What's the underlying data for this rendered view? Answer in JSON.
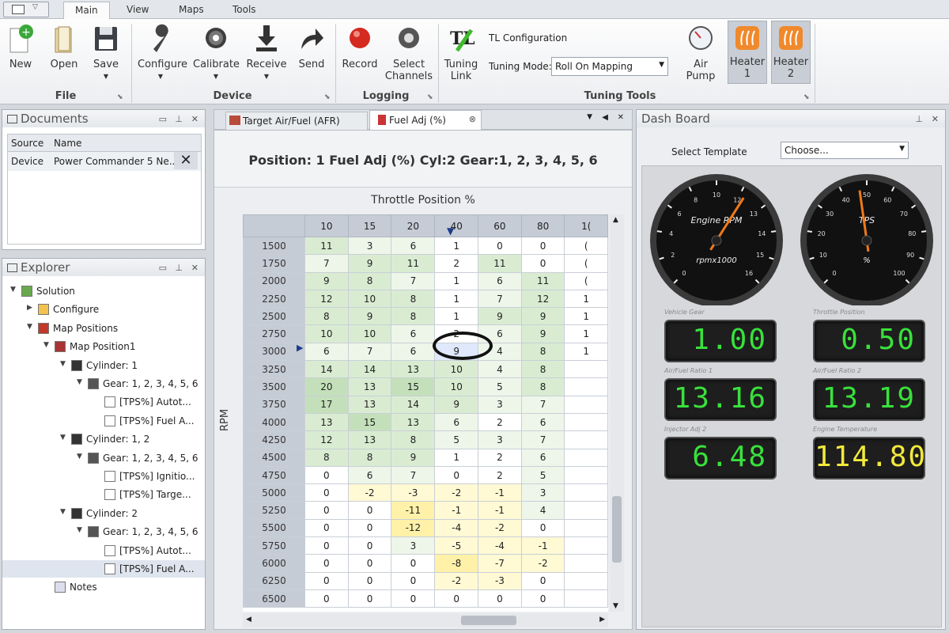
{
  "ribbon": {
    "tabs": [
      "Main",
      "View",
      "Maps",
      "Tools"
    ],
    "file_group": "File",
    "device_group": "Device",
    "logging_group": "Logging",
    "tuning_tools_group": "Tuning Tools",
    "new": "New",
    "open": "Open",
    "save": "Save",
    "configure": "Configure",
    "calibrate": "Calibrate",
    "receive": "Receive",
    "send": "Send",
    "record": "Record",
    "select_channels_1": "Select",
    "select_channels_2": "Channels",
    "tuning_link_1": "Tuning",
    "tuning_link_2": "Link",
    "tl_config": "TL Configuration",
    "tuning_mode_label": "Tuning Mode:",
    "tuning_mode_value": "Roll On Mapping",
    "air_pump": "Air Pump",
    "heater1_1": "Heater",
    "heater1_2": "1",
    "heater2_1": "Heater",
    "heater2_2": "2"
  },
  "documents": {
    "title": "Documents",
    "col_source": "Source",
    "col_name": "Name",
    "row_source": "Device",
    "row_name": "Power Commander 5 Ne..."
  },
  "explorer": {
    "title": "Explorer",
    "nodes": [
      "Solution",
      "Configure",
      "Map Positions",
      "Map Position1",
      "Cylinder: 1",
      "Gear: 1, 2, 3, 4, 5, 6",
      "[TPS%] Autot...",
      "[TPS%] Fuel A...",
      "Cylinder: 1, 2",
      "Gear: 1, 2, 3, 4, 5, 6",
      "[TPS%] Ignitio...",
      "[TPS%] Targe...",
      "Cylinder: 2",
      "Gear: 1, 2, 3, 4, 5, 6",
      "[TPS%] Autot...",
      "[TPS%] Fuel A...",
      "Notes"
    ]
  },
  "doctabs": {
    "tab1": "Target Air/Fuel (AFR)",
    "tab2": "Fuel Adj (%)"
  },
  "map": {
    "header": "Position: 1 Fuel Adj (%)  Cyl:2  Gear:1, 2, 3, 4, 5, 6",
    "x_axis_label": "Throttle Position %",
    "y_axis_label": "RPM",
    "columns": [
      "10",
      "15",
      "20",
      "40",
      "60",
      "80",
      "1("
    ],
    "rows": [
      {
        "rpm": "1500",
        "v": [
          "11",
          "3",
          "6",
          "1",
          "0",
          "0",
          "("
        ]
      },
      {
        "rpm": "1750",
        "v": [
          "7",
          "9",
          "11",
          "2",
          "11",
          "0",
          "("
        ]
      },
      {
        "rpm": "2000",
        "v": [
          "9",
          "8",
          "7",
          "1",
          "6",
          "11",
          "("
        ]
      },
      {
        "rpm": "2250",
        "v": [
          "12",
          "10",
          "8",
          "1",
          "7",
          "12",
          "1"
        ]
      },
      {
        "rpm": "2500",
        "v": [
          "8",
          "9",
          "8",
          "1",
          "9",
          "9",
          "1"
        ]
      },
      {
        "rpm": "2750",
        "v": [
          "10",
          "10",
          "6",
          "2",
          "6",
          "9",
          "1"
        ]
      },
      {
        "rpm": "3000",
        "v": [
          "6",
          "7",
          "6",
          "9",
          "4",
          "8",
          "1"
        ]
      },
      {
        "rpm": "3250",
        "v": [
          "14",
          "14",
          "13",
          "10",
          "4",
          "8",
          ""
        ]
      },
      {
        "rpm": "3500",
        "v": [
          "20",
          "13",
          "15",
          "10",
          "5",
          "8",
          ""
        ]
      },
      {
        "rpm": "3750",
        "v": [
          "17",
          "13",
          "14",
          "9",
          "3",
          "7",
          ""
        ]
      },
      {
        "rpm": "4000",
        "v": [
          "13",
          "15",
          "13",
          "6",
          "2",
          "6",
          ""
        ]
      },
      {
        "rpm": "4250",
        "v": [
          "12",
          "13",
          "8",
          "5",
          "3",
          "7",
          ""
        ]
      },
      {
        "rpm": "4500",
        "v": [
          "8",
          "8",
          "9",
          "1",
          "2",
          "6",
          ""
        ]
      },
      {
        "rpm": "4750",
        "v": [
          "0",
          "6",
          "7",
          "0",
          "2",
          "5",
          ""
        ]
      },
      {
        "rpm": "5000",
        "v": [
          "0",
          "-2",
          "-3",
          "-2",
          "-1",
          "3",
          ""
        ]
      },
      {
        "rpm": "5250",
        "v": [
          "0",
          "0",
          "-11",
          "-1",
          "-1",
          "4",
          ""
        ]
      },
      {
        "rpm": "5500",
        "v": [
          "0",
          "0",
          "-12",
          "-4",
          "-2",
          "0",
          ""
        ]
      },
      {
        "rpm": "5750",
        "v": [
          "0",
          "0",
          "3",
          "-5",
          "-4",
          "-1",
          ""
        ]
      },
      {
        "rpm": "6000",
        "v": [
          "0",
          "0",
          "0",
          "-8",
          "-7",
          "-2",
          ""
        ]
      },
      {
        "rpm": "6250",
        "v": [
          "0",
          "0",
          "0",
          "-2",
          "-3",
          "0",
          ""
        ]
      },
      {
        "rpm": "6500",
        "v": [
          "0",
          "0",
          "0",
          "0",
          "0",
          "0",
          ""
        ]
      }
    ]
  },
  "dashboard": {
    "title": "Dash Board",
    "select_template_label": "Select Template",
    "template_value": "Choose...",
    "rpm_gauge": {
      "title": "Engine RPM",
      "unit": "rpmx1000",
      "ticks": [
        "0",
        "2",
        "4",
        "6",
        "8",
        "10",
        "12",
        "13",
        "14",
        "15",
        "16"
      ]
    },
    "tps_gauge": {
      "title": "TPS",
      "unit": "%",
      "ticks": [
        "0",
        "10",
        "20",
        "30",
        "40",
        "50",
        "60",
        "70",
        "80",
        "90",
        "100"
      ]
    },
    "readouts": [
      {
        "caption": "Vehicle Gear",
        "value": "1.00",
        "color": "#39e13c"
      },
      {
        "caption": "Throttle Position",
        "value": "0.50",
        "color": "#39e13c"
      },
      {
        "caption": "Air/Fuel Ratio 1",
        "value": "13.16",
        "color": "#39e13c"
      },
      {
        "caption": "Air/Fuel Ratio 2",
        "value": "13.19",
        "color": "#39e13c"
      },
      {
        "caption": "Injector Adj 2",
        "value": "6.48",
        "color": "#39e13c"
      },
      {
        "caption": "Engine Temperature",
        "value": "114.80",
        "color": "#f2e93c"
      }
    ]
  }
}
